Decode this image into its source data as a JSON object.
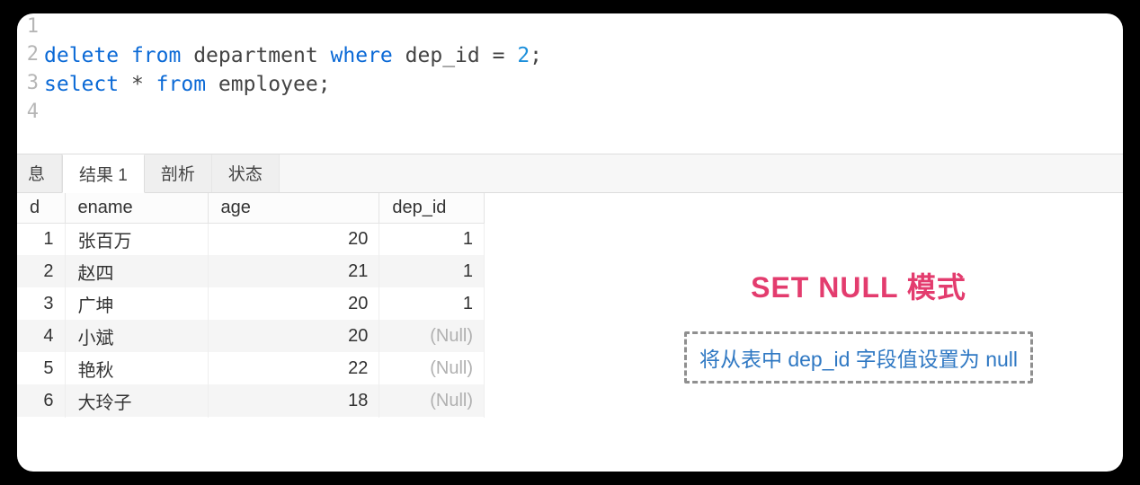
{
  "code": {
    "lines": [
      {
        "num": "1",
        "tokens": []
      },
      {
        "num": "2",
        "tokens": [
          {
            "cls": "kw",
            "t": "delete"
          },
          {
            "cls": "sp",
            "t": " "
          },
          {
            "cls": "kw",
            "t": "from"
          },
          {
            "cls": "sp",
            "t": " "
          },
          {
            "cls": "ident",
            "t": "department"
          },
          {
            "cls": "sp",
            "t": " "
          },
          {
            "cls": "kw",
            "t": "where"
          },
          {
            "cls": "sp",
            "t": " "
          },
          {
            "cls": "ident",
            "t": "dep_id"
          },
          {
            "cls": "sp",
            "t": " "
          },
          {
            "cls": "op",
            "t": "= "
          },
          {
            "cls": "num",
            "t": "2"
          },
          {
            "cls": "semi",
            "t": ";"
          }
        ]
      },
      {
        "num": "3",
        "tokens": [
          {
            "cls": "kw",
            "t": "select"
          },
          {
            "cls": "sp",
            "t": " "
          },
          {
            "cls": "star",
            "t": "*"
          },
          {
            "cls": "sp",
            "t": " "
          },
          {
            "cls": "kw",
            "t": "from"
          },
          {
            "cls": "sp",
            "t": " "
          },
          {
            "cls": "ident",
            "t": "employee"
          },
          {
            "cls": "semi",
            "t": ";"
          }
        ]
      },
      {
        "num": "4",
        "tokens": []
      }
    ]
  },
  "tabs": {
    "items": [
      {
        "label": "息",
        "active": false
      },
      {
        "label": "结果 1",
        "active": true
      },
      {
        "label": "剖析",
        "active": false
      },
      {
        "label": "状态",
        "active": false
      }
    ]
  },
  "table": {
    "headers": {
      "id": "d",
      "ename": "ename",
      "age": "age",
      "dep_id": "dep_id"
    },
    "rows": [
      {
        "id": "1",
        "ename": "张百万",
        "age": "20",
        "dep_id": "1",
        "null": false
      },
      {
        "id": "2",
        "ename": "赵四",
        "age": "21",
        "dep_id": "1",
        "null": false
      },
      {
        "id": "3",
        "ename": "广坤",
        "age": "20",
        "dep_id": "1",
        "null": false
      },
      {
        "id": "4",
        "ename": "小斌",
        "age": "20",
        "dep_id": "(Null)",
        "null": true
      },
      {
        "id": "5",
        "ename": "艳秋",
        "age": "22",
        "dep_id": "(Null)",
        "null": true
      },
      {
        "id": "6",
        "ename": "大玲子",
        "age": "18",
        "dep_id": "(Null)",
        "null": true
      }
    ]
  },
  "annotations": {
    "title": "SET NULL 模式",
    "note": "将从表中 dep_id 字段值设置为 null"
  }
}
